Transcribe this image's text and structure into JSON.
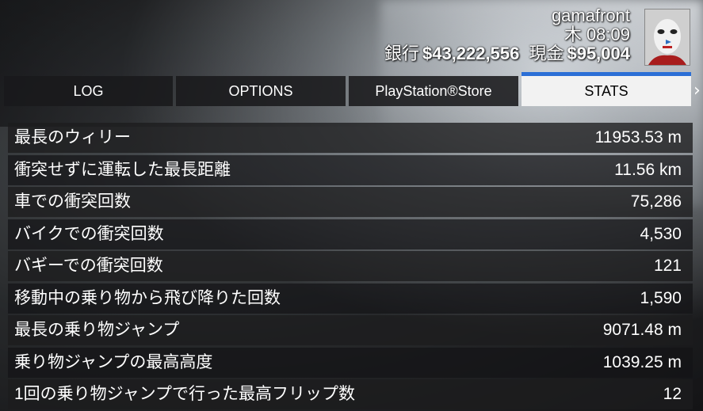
{
  "player": {
    "name": "gamafront",
    "clock": "木 08:09",
    "bank_label": "銀行",
    "bank_value": "$43,222,556",
    "cash_label": "現金",
    "cash_value": "$95,004"
  },
  "tabs": [
    {
      "label": "LOG",
      "active": false
    },
    {
      "label": "OPTIONS",
      "active": false
    },
    {
      "label": "PlayStation®Store",
      "active": false
    },
    {
      "label": "STATS",
      "active": true
    }
  ],
  "tab_next_glyph": "›",
  "stats": [
    {
      "label": "最長のウィリー",
      "value": "11953.53 m"
    },
    {
      "label": "衝突せずに運転した最長距離",
      "value": "11.56 km"
    },
    {
      "label": "車での衝突回数",
      "value": "75,286"
    },
    {
      "label": "バイクでの衝突回数",
      "value": "4,530"
    },
    {
      "label": "バギーでの衝突回数",
      "value": "121"
    },
    {
      "label": "移動中の乗り物から飛び降りた回数",
      "value": "1,590"
    },
    {
      "label": "最長の乗り物ジャンプ",
      "value": "9071.48 m"
    },
    {
      "label": "乗り物ジャンプの最高高度",
      "value": "1039.25 m"
    },
    {
      "label": "1回の乗り物ジャンプで行った最高フリップ数",
      "value": "12"
    }
  ],
  "colors": {
    "accent": "#2b6fd6",
    "active_tab_bg": "#f2f2f2",
    "panel_bg": "#1c1c1e"
  }
}
